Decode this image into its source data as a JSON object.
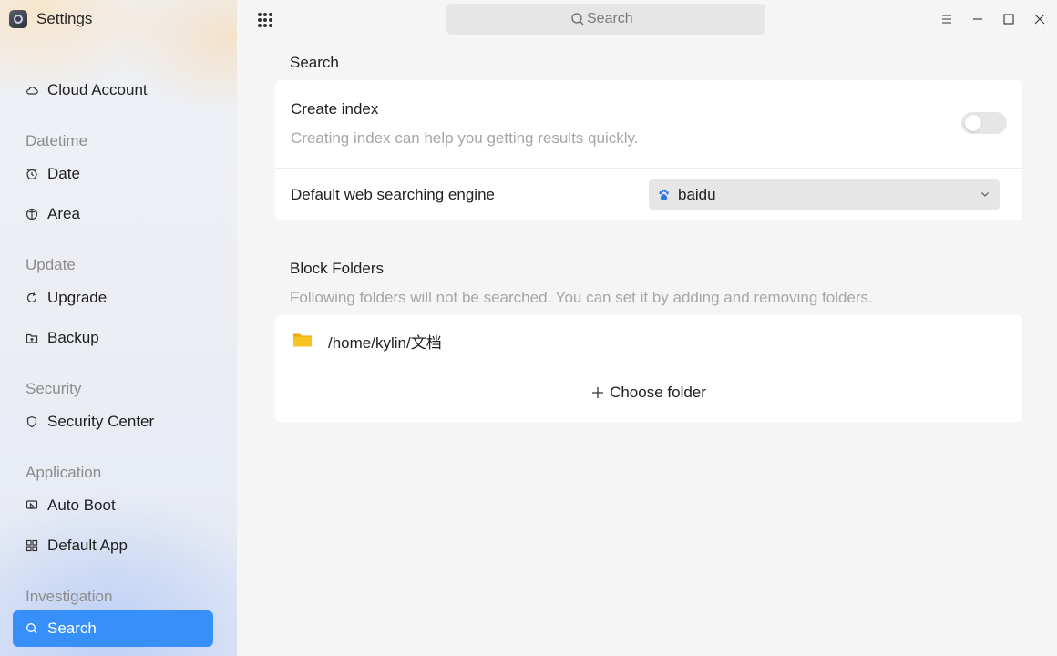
{
  "app": {
    "title": "Settings"
  },
  "sidebar": {
    "items": [
      {
        "label": "Cloud Account",
        "icon": "cloud-icon"
      },
      {
        "group": "Datetime"
      },
      {
        "label": "Date",
        "icon": "clock-icon"
      },
      {
        "label": "Area",
        "icon": "globe-icon"
      },
      {
        "group": "Update"
      },
      {
        "label": "Upgrade",
        "icon": "refresh-icon"
      },
      {
        "label": "Backup",
        "icon": "backup-icon"
      },
      {
        "group": "Security"
      },
      {
        "label": "Security Center",
        "icon": "shield-icon"
      },
      {
        "group": "Application"
      },
      {
        "label": "Auto Boot",
        "icon": "autoboot-icon"
      },
      {
        "label": "Default App",
        "icon": "grid-icon"
      },
      {
        "group": "Investigation"
      },
      {
        "label": "Search",
        "icon": "search-icon",
        "active": true
      }
    ]
  },
  "header": {
    "search_placeholder": "Search"
  },
  "search_section": {
    "title": "Search",
    "create_index": {
      "label": "Create index",
      "description": "Creating index can help you getting results quickly.",
      "enabled": false
    },
    "engine": {
      "label": "Default web searching engine",
      "selected": "baidu",
      "icon": "baidu-paw-icon"
    }
  },
  "block_folders": {
    "title": "Block Folders",
    "description": "Following folders will not be searched. You can set it by adding and removing folders.",
    "folders": [
      "/home/kylin/文档"
    ],
    "choose_label": "Choose folder"
  },
  "colors": {
    "accent": "#3790fa",
    "muted_text": "#a6a6a6",
    "group_text": "#8c8c8c",
    "folder": "#f7c325",
    "baidu": "#3377e0"
  }
}
